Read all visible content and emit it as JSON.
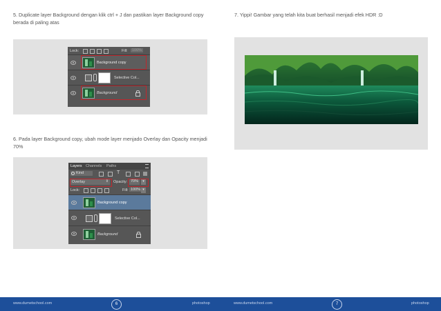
{
  "left": {
    "step5": "5. Duplicate layer Background dengan klik ctrl + J dan pastikan layer Background copy berada di paling atas",
    "step6": "6. Pada layer Background copy, ubah mode layer menjado Overlay dan Opacity menjadi 70%",
    "panel1": {
      "lock_label": "Lock:",
      "fill_label": "Fill:",
      "fill_value": "100%",
      "layers": [
        "Background copy",
        "Selective Col...",
        "Background"
      ]
    },
    "panel2": {
      "tabs": [
        "Layers",
        "Channels",
        "Paths"
      ],
      "kind_label": "Kind",
      "blend_mode": "Overlay",
      "opacity_label": "Opacity:",
      "opacity_value": "70%",
      "lock_label": "Lock:",
      "fill_label": "Fill:",
      "fill_value": "100%",
      "layers": [
        "Background copy",
        "Selective Col...",
        "Background"
      ]
    }
  },
  "right": {
    "step7": "7. Yippi! Gambar yang telah kita buat berhasil menjadi efek HDR :D"
  },
  "footer": {
    "left_site": "www.dumetschool.com",
    "left_page": "6",
    "left_topic": "photoshop",
    "right_site": "www.dumetschool.com",
    "right_page": "7",
    "right_topic": "photoshop"
  },
  "colors": {
    "footer_bg": "#1d4f9a",
    "highlight_red": "#c0272d",
    "panel_gray": "#565656",
    "selected_layer": "#5b7a9c"
  }
}
